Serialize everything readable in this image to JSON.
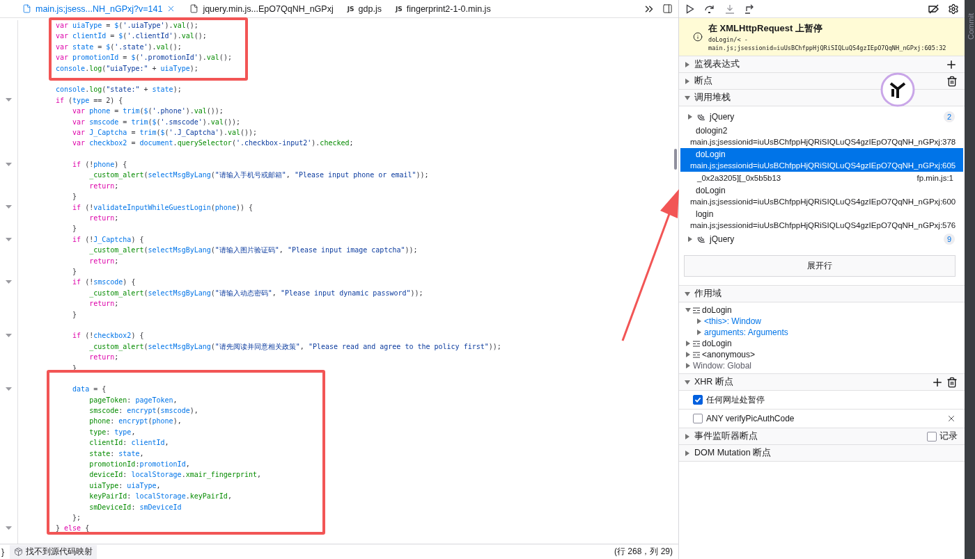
{
  "editor": {
    "tabs": [
      {
        "label": "main.js;jsess...NH_nGPxj?v=141",
        "kind": "file",
        "selected": true
      },
      {
        "label": "jquery.min.js...EpO7QqNH_nGPxj",
        "kind": "file",
        "selected": false
      },
      {
        "label": "gdp.js",
        "kind": "js",
        "badge": "JS",
        "selected": false
      },
      {
        "label": "fingerprint2-1-0.min.js",
        "kind": "js",
        "badge": "JS",
        "selected": false
      }
    ],
    "code_lines": [
      {
        "fold": false,
        "tokens": [
          {
            "kind": "kw",
            "text": "var "
          },
          {
            "kind": "id",
            "text": "uiaType"
          },
          {
            "kind": "punc",
            "text": " = "
          },
          {
            "kind": "id",
            "text": "$"
          },
          {
            "kind": "punc",
            "text": "("
          },
          {
            "kind": "str",
            "text": "'.uiaType'"
          },
          {
            "kind": "punc",
            "text": ")."
          },
          {
            "kind": "prop",
            "text": "val"
          },
          {
            "kind": "punc",
            "text": "();"
          }
        ]
      },
      {
        "fold": false,
        "tokens": [
          {
            "kind": "kw",
            "text": "var "
          },
          {
            "kind": "id",
            "text": "clientId"
          },
          {
            "kind": "punc",
            "text": " = "
          },
          {
            "kind": "id",
            "text": "$"
          },
          {
            "kind": "punc",
            "text": "("
          },
          {
            "kind": "str",
            "text": "'.clientId'"
          },
          {
            "kind": "punc",
            "text": ")."
          },
          {
            "kind": "prop",
            "text": "val"
          },
          {
            "kind": "punc",
            "text": "();"
          }
        ]
      },
      {
        "fold": false,
        "tokens": [
          {
            "kind": "kw",
            "text": "var "
          },
          {
            "kind": "id",
            "text": "state"
          },
          {
            "kind": "punc",
            "text": " = "
          },
          {
            "kind": "id",
            "text": "$"
          },
          {
            "kind": "punc",
            "text": "("
          },
          {
            "kind": "str",
            "text": "'.state'"
          },
          {
            "kind": "punc",
            "text": ")."
          },
          {
            "kind": "prop",
            "text": "val"
          },
          {
            "kind": "punc",
            "text": "();"
          }
        ]
      },
      {
        "fold": false,
        "tokens": [
          {
            "kind": "kw",
            "text": "var "
          },
          {
            "kind": "id",
            "text": "promotionId"
          },
          {
            "kind": "punc",
            "text": " = "
          },
          {
            "kind": "id",
            "text": "$"
          },
          {
            "kind": "punc",
            "text": "("
          },
          {
            "kind": "str",
            "text": "'.promotionId'"
          },
          {
            "kind": "punc",
            "text": ")."
          },
          {
            "kind": "prop",
            "text": "val"
          },
          {
            "kind": "punc",
            "text": "();"
          }
        ]
      },
      {
        "fold": false,
        "tokens": [
          {
            "kind": "id",
            "text": "console"
          },
          {
            "kind": "punc",
            "text": "."
          },
          {
            "kind": "prop",
            "text": "log"
          },
          {
            "kind": "punc",
            "text": "("
          },
          {
            "kind": "str",
            "text": "\"uiaType:\""
          },
          {
            "kind": "punc",
            "text": " + "
          },
          {
            "kind": "id",
            "text": "uiaType"
          },
          {
            "kind": "punc",
            "text": ");"
          }
        ]
      },
      {
        "fold": false
      },
      {
        "fold": false,
        "tokens": [
          {
            "kind": "id",
            "text": "console"
          },
          {
            "kind": "punc",
            "text": "."
          },
          {
            "kind": "prop",
            "text": "log"
          },
          {
            "kind": "punc",
            "text": "("
          },
          {
            "kind": "str",
            "text": "\"state:\""
          },
          {
            "kind": "punc",
            "text": " + "
          },
          {
            "kind": "id",
            "text": "state"
          },
          {
            "kind": "punc",
            "text": ");"
          }
        ]
      },
      {
        "fold": true,
        "tokens": [
          {
            "kind": "kw",
            "text": "if"
          },
          {
            "kind": "punc",
            "text": " ("
          },
          {
            "kind": "id",
            "text": "type"
          },
          {
            "kind": "punc",
            "text": " == 2) {"
          }
        ]
      },
      {
        "fold": false,
        "tokens": [
          {
            "kind": "kw",
            "text": "    var "
          },
          {
            "kind": "id",
            "text": "phone"
          },
          {
            "kind": "punc",
            "text": " = "
          },
          {
            "kind": "id",
            "text": "trim"
          },
          {
            "kind": "punc",
            "text": "("
          },
          {
            "kind": "id",
            "text": "$"
          },
          {
            "kind": "punc",
            "text": "("
          },
          {
            "kind": "str",
            "text": "'.phone'"
          },
          {
            "kind": "punc",
            "text": ")."
          },
          {
            "kind": "prop",
            "text": "val"
          },
          {
            "kind": "punc",
            "text": "());"
          }
        ]
      },
      {
        "fold": false,
        "tokens": [
          {
            "kind": "kw",
            "text": "    var "
          },
          {
            "kind": "id",
            "text": "smscode"
          },
          {
            "kind": "punc",
            "text": " = "
          },
          {
            "kind": "id",
            "text": "trim"
          },
          {
            "kind": "punc",
            "text": "("
          },
          {
            "kind": "id",
            "text": "$"
          },
          {
            "kind": "punc",
            "text": "("
          },
          {
            "kind": "str",
            "text": "'.smscode'"
          },
          {
            "kind": "punc",
            "text": ")."
          },
          {
            "kind": "prop",
            "text": "val"
          },
          {
            "kind": "punc",
            "text": "());"
          }
        ]
      },
      {
        "fold": false,
        "tokens": [
          {
            "kind": "kw",
            "text": "    var "
          },
          {
            "kind": "id",
            "text": "J_Captcha"
          },
          {
            "kind": "punc",
            "text": " = "
          },
          {
            "kind": "id",
            "text": "trim"
          },
          {
            "kind": "punc",
            "text": "("
          },
          {
            "kind": "id",
            "text": "$"
          },
          {
            "kind": "punc",
            "text": "("
          },
          {
            "kind": "str",
            "text": "'.J_Captcha'"
          },
          {
            "kind": "punc",
            "text": ")."
          },
          {
            "kind": "prop",
            "text": "val"
          },
          {
            "kind": "punc",
            "text": "());"
          }
        ]
      },
      {
        "fold": false,
        "tokens": [
          {
            "kind": "kw",
            "text": "    var "
          },
          {
            "kind": "id",
            "text": "checkbox2"
          },
          {
            "kind": "punc",
            "text": " = "
          },
          {
            "kind": "id",
            "text": "document"
          },
          {
            "kind": "punc",
            "text": "."
          },
          {
            "kind": "prop",
            "text": "querySelector"
          },
          {
            "kind": "punc",
            "text": "("
          },
          {
            "kind": "str",
            "text": "'.checkbox-input2'"
          },
          {
            "kind": "punc",
            "text": ")."
          },
          {
            "kind": "prop",
            "text": "checked"
          },
          {
            "kind": "punc",
            "text": ";"
          }
        ]
      },
      {
        "fold": false
      },
      {
        "fold": true,
        "tokens": [
          {
            "kind": "kw",
            "text": "    if"
          },
          {
            "kind": "punc",
            "text": " (!"
          },
          {
            "kind": "id",
            "text": "phone"
          },
          {
            "kind": "punc",
            "text": ") {"
          }
        ]
      },
      {
        "fold": false,
        "tokens": [
          {
            "kind": "prop",
            "text": "        _custom_alert"
          },
          {
            "kind": "punc",
            "text": "("
          },
          {
            "kind": "id",
            "text": "selectMsgByLang"
          },
          {
            "kind": "punc",
            "text": "("
          },
          {
            "kind": "str",
            "text": "\"请输入手机号或邮箱\""
          },
          {
            "kind": "punc",
            "text": ", "
          },
          {
            "kind": "str",
            "text": "\"Please input phone or email\""
          },
          {
            "kind": "punc",
            "text": "));"
          }
        ]
      },
      {
        "fold": false,
        "tokens": [
          {
            "kind": "kw",
            "text": "        return"
          },
          {
            "kind": "punc",
            "text": ";"
          }
        ]
      },
      {
        "fold": false,
        "tokens": [
          {
            "kind": "punc",
            "text": "    }"
          }
        ]
      },
      {
        "fold": true,
        "tokens": [
          {
            "kind": "kw",
            "text": "    if"
          },
          {
            "kind": "punc",
            "text": " (!"
          },
          {
            "kind": "id",
            "text": "validateInputWhileGuestLogin"
          },
          {
            "kind": "punc",
            "text": "("
          },
          {
            "kind": "id",
            "text": "phone"
          },
          {
            "kind": "punc",
            "text": ")) {"
          }
        ]
      },
      {
        "fold": false,
        "tokens": [
          {
            "kind": "kw",
            "text": "        return"
          },
          {
            "kind": "punc",
            "text": ";"
          }
        ]
      },
      {
        "fold": false,
        "tokens": [
          {
            "kind": "punc",
            "text": "    }"
          }
        ]
      },
      {
        "fold": true,
        "tokens": [
          {
            "kind": "kw",
            "text": "    if"
          },
          {
            "kind": "punc",
            "text": " (!"
          },
          {
            "kind": "id",
            "text": "J_Captcha"
          },
          {
            "kind": "punc",
            "text": ") {"
          }
        ]
      },
      {
        "fold": false,
        "tokens": [
          {
            "kind": "prop",
            "text": "        _custom_alert"
          },
          {
            "kind": "punc",
            "text": "("
          },
          {
            "kind": "id",
            "text": "selectMsgByLang"
          },
          {
            "kind": "punc",
            "text": "("
          },
          {
            "kind": "str",
            "text": "\"请输入图片验证码\""
          },
          {
            "kind": "punc",
            "text": ", "
          },
          {
            "kind": "str",
            "text": "\"Please input image captcha\""
          },
          {
            "kind": "punc",
            "text": "));"
          }
        ]
      },
      {
        "fold": false,
        "tokens": [
          {
            "kind": "kw",
            "text": "        return"
          },
          {
            "kind": "punc",
            "text": ";"
          }
        ]
      },
      {
        "fold": false,
        "tokens": [
          {
            "kind": "punc",
            "text": "    }"
          }
        ]
      },
      {
        "fold": true,
        "tokens": [
          {
            "kind": "kw",
            "text": "    if"
          },
          {
            "kind": "punc",
            "text": " (!"
          },
          {
            "kind": "id",
            "text": "smscode"
          },
          {
            "kind": "punc",
            "text": ") {"
          }
        ]
      },
      {
        "fold": false,
        "tokens": [
          {
            "kind": "prop",
            "text": "        _custom_alert"
          },
          {
            "kind": "punc",
            "text": "("
          },
          {
            "kind": "id",
            "text": "selectMsgByLang"
          },
          {
            "kind": "punc",
            "text": "("
          },
          {
            "kind": "str",
            "text": "\"请输入动态密码\""
          },
          {
            "kind": "punc",
            "text": ", "
          },
          {
            "kind": "str",
            "text": "\"Please input dynamic password\""
          },
          {
            "kind": "punc",
            "text": "));"
          }
        ]
      },
      {
        "fold": false,
        "tokens": [
          {
            "kind": "kw",
            "text": "        return"
          },
          {
            "kind": "punc",
            "text": ";"
          }
        ]
      },
      {
        "fold": false,
        "tokens": [
          {
            "kind": "punc",
            "text": "    }"
          }
        ]
      },
      {
        "fold": false
      },
      {
        "fold": true,
        "tokens": [
          {
            "kind": "kw",
            "text": "    if"
          },
          {
            "kind": "punc",
            "text": " (!"
          },
          {
            "kind": "id",
            "text": "checkbox2"
          },
          {
            "kind": "punc",
            "text": ") {"
          }
        ]
      },
      {
        "fold": false,
        "tokens": [
          {
            "kind": "prop",
            "text": "        _custom_alert"
          },
          {
            "kind": "punc",
            "text": "("
          },
          {
            "kind": "id",
            "text": "selectMsgByLang"
          },
          {
            "kind": "punc",
            "text": "("
          },
          {
            "kind": "str",
            "text": "\"请先阅读并同意相关政策\""
          },
          {
            "kind": "punc",
            "text": ", "
          },
          {
            "kind": "str",
            "text": "\"Please read and agree to the policy first\""
          },
          {
            "kind": "punc",
            "text": "));"
          }
        ]
      },
      {
        "fold": false,
        "tokens": [
          {
            "kind": "kw",
            "text": "        return"
          },
          {
            "kind": "punc",
            "text": ";"
          }
        ]
      },
      {
        "fold": false,
        "tokens": [
          {
            "kind": "punc",
            "text": "    }"
          }
        ]
      },
      {
        "fold": false
      },
      {
        "fold": true,
        "tokens": [
          {
            "kind": "id",
            "text": "    data"
          },
          {
            "kind": "punc",
            "text": " = {"
          }
        ]
      },
      {
        "fold": false,
        "tokens": [
          {
            "kind": "prop",
            "text": "        pageToken"
          },
          {
            "kind": "punc",
            "text": ": "
          },
          {
            "kind": "id",
            "text": "pageToken"
          },
          {
            "kind": "punc",
            "text": ","
          }
        ]
      },
      {
        "fold": false,
        "tokens": [
          {
            "kind": "prop",
            "text": "        smscode"
          },
          {
            "kind": "punc",
            "text": ": "
          },
          {
            "kind": "id",
            "text": "encrypt"
          },
          {
            "kind": "punc",
            "text": "("
          },
          {
            "kind": "id",
            "text": "smscode"
          },
          {
            "kind": "punc",
            "text": "),"
          }
        ]
      },
      {
        "fold": false,
        "tokens": [
          {
            "kind": "prop",
            "text": "        phone"
          },
          {
            "kind": "punc",
            "text": ": "
          },
          {
            "kind": "id",
            "text": "encrypt"
          },
          {
            "kind": "punc",
            "text": "("
          },
          {
            "kind": "id",
            "text": "phone"
          },
          {
            "kind": "punc",
            "text": "),"
          }
        ]
      },
      {
        "fold": false,
        "tokens": [
          {
            "kind": "prop",
            "text": "        type"
          },
          {
            "kind": "punc",
            "text": ": "
          },
          {
            "kind": "id",
            "text": "type"
          },
          {
            "kind": "punc",
            "text": ","
          }
        ]
      },
      {
        "fold": false,
        "tokens": [
          {
            "kind": "prop",
            "text": "        clientId"
          },
          {
            "kind": "punc",
            "text": ": "
          },
          {
            "kind": "id",
            "text": "clientId"
          },
          {
            "kind": "punc",
            "text": ","
          }
        ]
      },
      {
        "fold": false,
        "tokens": [
          {
            "kind": "prop",
            "text": "        state"
          },
          {
            "kind": "punc",
            "text": ": "
          },
          {
            "kind": "id",
            "text": "state"
          },
          {
            "kind": "punc",
            "text": ","
          }
        ]
      },
      {
        "fold": false,
        "tokens": [
          {
            "kind": "prop",
            "text": "        promotionId"
          },
          {
            "kind": "punc",
            "text": ":"
          },
          {
            "kind": "id",
            "text": "promotionId"
          },
          {
            "kind": "punc",
            "text": ","
          }
        ]
      },
      {
        "fold": false,
        "tokens": [
          {
            "kind": "prop",
            "text": "        deviceId"
          },
          {
            "kind": "punc",
            "text": ": "
          },
          {
            "kind": "id",
            "text": "localStorage"
          },
          {
            "kind": "punc",
            "text": "."
          },
          {
            "kind": "prop",
            "text": "xmair_fingerprint"
          },
          {
            "kind": "punc",
            "text": ","
          }
        ]
      },
      {
        "fold": false,
        "tokens": [
          {
            "kind": "prop",
            "text": "        uiaType"
          },
          {
            "kind": "punc",
            "text": ": "
          },
          {
            "kind": "id",
            "text": "uiaType"
          },
          {
            "kind": "punc",
            "text": ","
          }
        ]
      },
      {
        "fold": false,
        "tokens": [
          {
            "kind": "prop",
            "text": "        keyPairId"
          },
          {
            "kind": "punc",
            "text": ": "
          },
          {
            "kind": "id",
            "text": "localStorage"
          },
          {
            "kind": "punc",
            "text": "."
          },
          {
            "kind": "prop",
            "text": "keyPairId"
          },
          {
            "kind": "punc",
            "text": ","
          }
        ]
      },
      {
        "fold": false,
        "tokens": [
          {
            "kind": "prop",
            "text": "        smDeviceId"
          },
          {
            "kind": "punc",
            "text": ": "
          },
          {
            "kind": "id",
            "text": "smDeviceId"
          }
        ]
      },
      {
        "fold": false,
        "tokens": [
          {
            "kind": "punc",
            "text": "    };"
          }
        ]
      },
      {
        "fold": true,
        "tokens": [
          {
            "kind": "punc",
            "text": "} "
          },
          {
            "kind": "kw",
            "text": "else"
          },
          {
            "kind": "punc",
            "text": " {"
          }
        ]
      }
    ],
    "status_bar": {
      "brace": "}",
      "message": "找不到源代码映射",
      "position": "(行 268，列 29)"
    }
  },
  "debugger": {
    "banner": {
      "title": "在 XMLHttpRequest 上暂停",
      "frame": "doLogin/< -",
      "location": "main.js;jsessionid=iuUsBChfppHjQRiSIQLuQS4gzIEpO7QqNH_nGPxj:605:32"
    },
    "sections": [
      {
        "kind": "watch",
        "title": "监视表达式",
        "expanded": false
      },
      {
        "kind": "breakpoints",
        "title": "断点",
        "expanded": false
      },
      {
        "kind": "callstack",
        "title": "调用堆栈",
        "expanded": true,
        "button": "展开行",
        "frames": [
          {
            "kind": "group",
            "name": "jQuery",
            "count": "2",
            "selected": false
          },
          {
            "kind": "frame",
            "name": "dologin2",
            "location": "main.js;jsessionid=iuUsBChfppHjQRiSIQLuQS4gzIEpO7QqNH_nGPxj:378",
            "selected": false
          },
          {
            "kind": "frame",
            "name": "doLogin",
            "location": "main.js;jsessionid=iuUsBChfppHjQRiSIQLuQS4gzIEpO7QqNH_nGPxj:605",
            "selected": true
          },
          {
            "kind": "inline",
            "name": "_0x2a3205][_0x5b5b13",
            "location": "fp.min.js:1",
            "selected": false
          },
          {
            "kind": "frame",
            "name": "doLogin",
            "location": "main.js;jsessionid=iuUsBChfppHjQRiSIQLuQS4gzIEpO7QqNH_nGPxj:600",
            "selected": false
          },
          {
            "kind": "frame",
            "name": "login",
            "location": "main.js;jsessionid=iuUsBChfppHjQRiSIQLuQS4gzIEpO7QqNH_nGPxj:576",
            "selected": false
          },
          {
            "kind": "group",
            "name": "jQuery",
            "count": "9",
            "selected": false
          }
        ]
      },
      {
        "kind": "scopes",
        "title": "作用域",
        "expanded": true,
        "tree": [
          {
            "kind": "block",
            "label": "doLogin",
            "expanded": true,
            "children": [
              {
                "kind": "object",
                "label": "<this>: Window",
                "expanded": false
              },
              {
                "kind": "object",
                "label": "arguments: Arguments",
                "expanded": false
              }
            ]
          },
          {
            "kind": "block",
            "label": "doLogin",
            "expanded": false
          },
          {
            "kind": "block",
            "label": "<anonymous>",
            "expanded": false
          },
          {
            "kind": "global",
            "label": "Window: Global",
            "expanded": false
          }
        ]
      },
      {
        "kind": "xhr",
        "title": "XHR 断点",
        "expanded": true,
        "items": [
          {
            "label": "任何网址处暂停",
            "checked": true,
            "removable": false
          },
          {
            "label": "ANY verifyPicAuthCode",
            "checked": false,
            "removable": true
          }
        ]
      },
      {
        "kind": "events",
        "title": "事件监听器断点",
        "expanded": false,
        "log": {
          "label": "记录",
          "checked": false
        }
      },
      {
        "kind": "dom",
        "title": "DOM Mutation 断点",
        "expanded": false
      }
    ]
  },
  "side_strip": {
    "label": "Commit"
  }
}
